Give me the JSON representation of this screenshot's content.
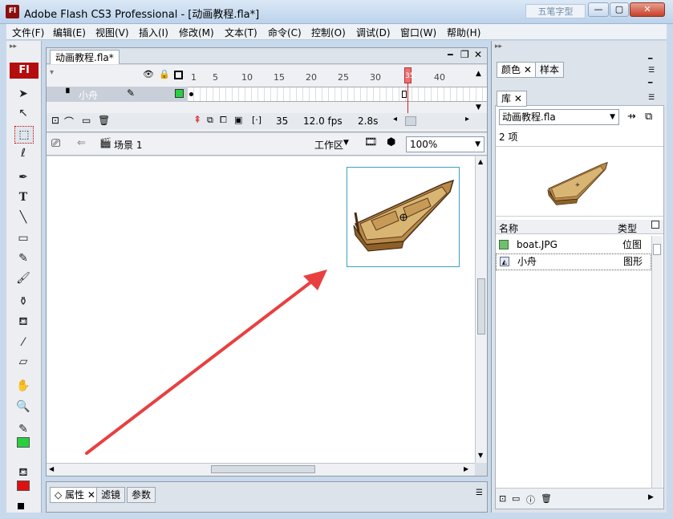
{
  "window": {
    "title": "Adobe Flash CS3 Professional - [动画教程.fla*]",
    "app_icon": "Fl",
    "watermark": "五笔字型",
    "controls": {
      "minimize": "—",
      "maximize": "▢",
      "close": "✕"
    }
  },
  "menu": [
    "文件(F)",
    "编辑(E)",
    "视图(V)",
    "插入(I)",
    "修改(M)",
    "文本(T)",
    "命令(C)",
    "控制(O)",
    "调试(D)",
    "窗口(W)",
    "帮助(H)"
  ],
  "toolbar": {
    "logo": "Fl"
  },
  "document": {
    "tab_label": "动画教程.fla*",
    "timeline": {
      "frame_numbers": [
        "1",
        "5",
        "10",
        "15",
        "20",
        "25",
        "30",
        "35",
        "40"
      ],
      "layer_name": "小舟",
      "current_frame": "35",
      "fps": "12.0 fps",
      "time": "2.8s",
      "playhead_label": "35"
    },
    "edit_bar": {
      "scene": "场景 1",
      "workspace": "工作区",
      "zoom": "100%"
    }
  },
  "properties_panel": {
    "tabs": [
      "属性",
      "滤镜",
      "参数"
    ]
  },
  "right_panel": {
    "top_tabs": [
      "颜色",
      "样本"
    ],
    "library_tab": "库",
    "library": {
      "file": "动画教程.fla",
      "count": "2 项",
      "headers": {
        "name": "名称",
        "type": "类型"
      },
      "items": [
        {
          "name": "boat.JPG",
          "type": "位图"
        },
        {
          "name": "小舟",
          "type": "图形"
        }
      ]
    }
  },
  "colors": {
    "stroke": "#000000",
    "fill_green": "#28d040",
    "fill_red": "#e01010",
    "annotation_arrow": "#e84040"
  }
}
